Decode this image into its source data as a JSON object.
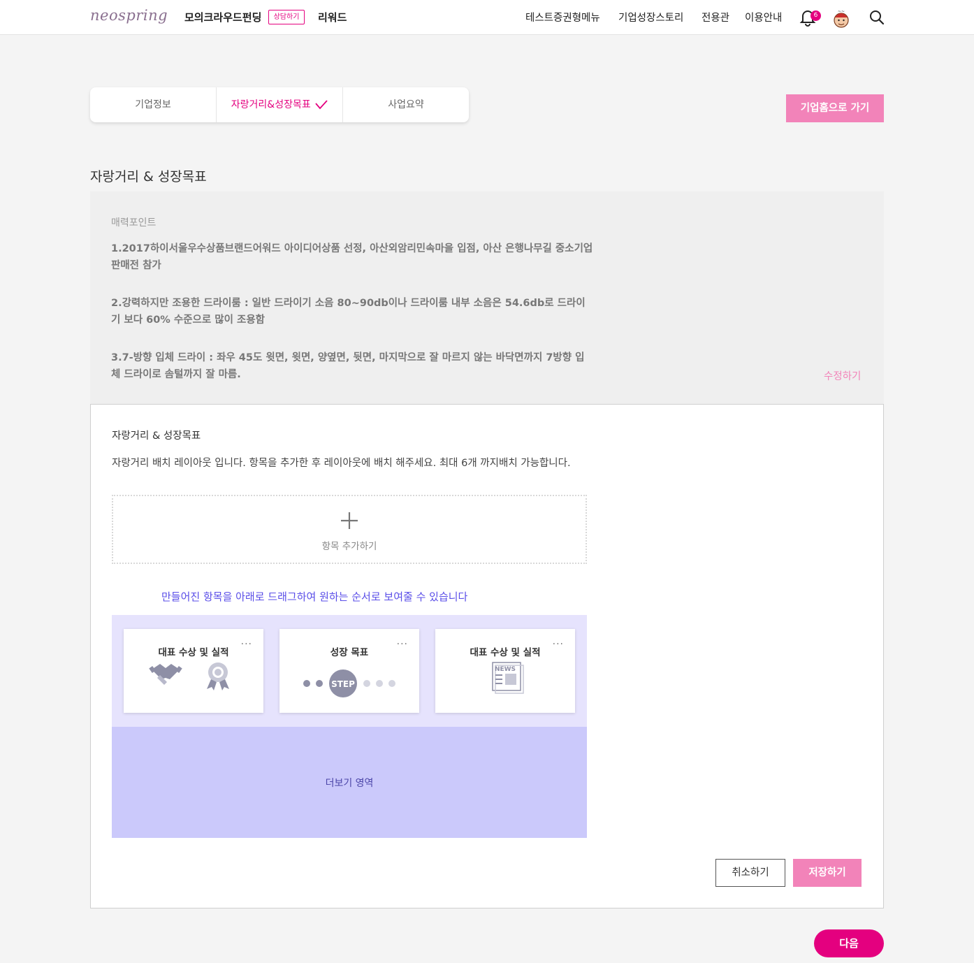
{
  "header": {
    "logo": "neospring",
    "nav_funding": "모의크라우드펀딩",
    "nav_consult_badge": "상담하기",
    "nav_reward": "리워드",
    "nav_items": [
      "테스트증권형메뉴",
      "기업성장스토리",
      "전용관",
      "이용안내"
    ],
    "notification_count": "6"
  },
  "tabs": {
    "items": [
      "기업정보",
      "자랑거리&성장목표",
      "사업요약"
    ],
    "active_index": 1
  },
  "go_home_button": "기업홈으로 가기",
  "section_title": "자랑거리 & 성장목표",
  "appeal": {
    "label": "매력포인트",
    "items": [
      "1.2017하이서울우수상품브랜드어워드 아이디어상품 선정, 아산외암리민속마을 입점, 아산 은행나무길 중소기업판매전 참가",
      "2.강력하지만 조용한 드라이룸 : 일반 드라이기 소음 80~90db이나 드라이룸 내부 소음은 54.6db로 드라이기 보다 60% 수준으로 많이 조용함",
      "3.7-방향 입체 드라이 : 좌우 45도 윗면, 윗면, 양옆면, 뒷면, 마지막으로 잘 마르지 않는 바닥면까지 7방향 입체 드라이로 솜털까지 잘 마름."
    ],
    "edit_link": "수정하기"
  },
  "panel": {
    "title": "자랑거리 & 성장목표",
    "description": "자랑거리 배치 레이아웃 입니다. 항목을 추가한 후 레이아웃에 배치 해주세요. 최대 6개 까지배치 가능합니다.",
    "add_item_label": "항목 추가하기",
    "drag_hint": "만들어진 항목을 아래로 드래그하여 원하는 순서로 보여줄 수 있습니다",
    "cards": [
      {
        "title": "대표 수상 및 실적",
        "menu": "···",
        "icon": "handshake-award-icon"
      },
      {
        "title": "성장 목표",
        "menu": "···",
        "icon": "step-progress-icon",
        "step_label": "STEP"
      },
      {
        "title": "대표 수상 및 실적",
        "menu": "···",
        "icon": "news-icon",
        "news_label": "NEWS"
      }
    ],
    "more_area_label": "더보기 영역",
    "cancel_button": "취소하기",
    "save_button": "저장하기"
  },
  "next_button": "다음",
  "colors": {
    "brand_pink": "#e4007f",
    "light_pink": "#f283b9",
    "hint_purple": "#5a4ee8",
    "layout_light": "#e6e3fd",
    "layout_more": "#cbc9fb"
  }
}
